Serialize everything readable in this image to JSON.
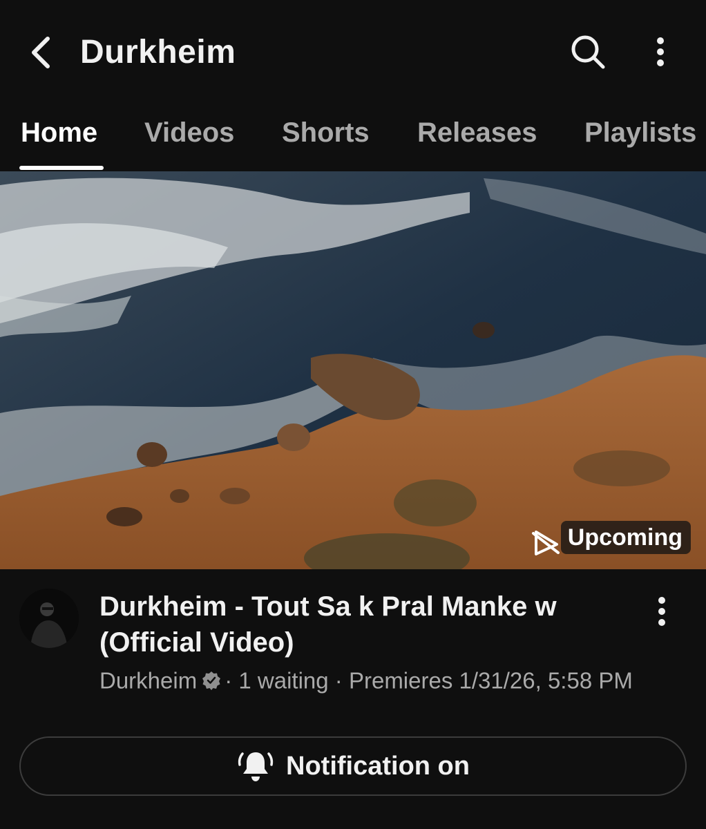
{
  "header": {
    "title": "Durkheim",
    "back_icon": "chevron-left-icon",
    "search_icon": "search-icon",
    "more_icon": "more-vertical-icon"
  },
  "tabs": [
    {
      "label": "Home",
      "active": true
    },
    {
      "label": "Videos",
      "active": false
    },
    {
      "label": "Shorts",
      "active": false
    },
    {
      "label": "Releases",
      "active": false
    },
    {
      "label": "Playlists",
      "active": false
    }
  ],
  "video": {
    "badge": "Upcoming",
    "title": "Durkheim - Tout Sa k Pral Manke w (Official Video)",
    "channel": "Durkheim",
    "separator": "·",
    "waiting": "1 waiting",
    "premiere": "Premieres 1/31/26, 5:58 PM"
  },
  "notification": {
    "label": "Notification on",
    "icon": "bell-ringing-icon"
  },
  "colors": {
    "background": "#0f0f0f",
    "text_primary": "#f1f1f1",
    "text_secondary": "#aaaaaa"
  }
}
